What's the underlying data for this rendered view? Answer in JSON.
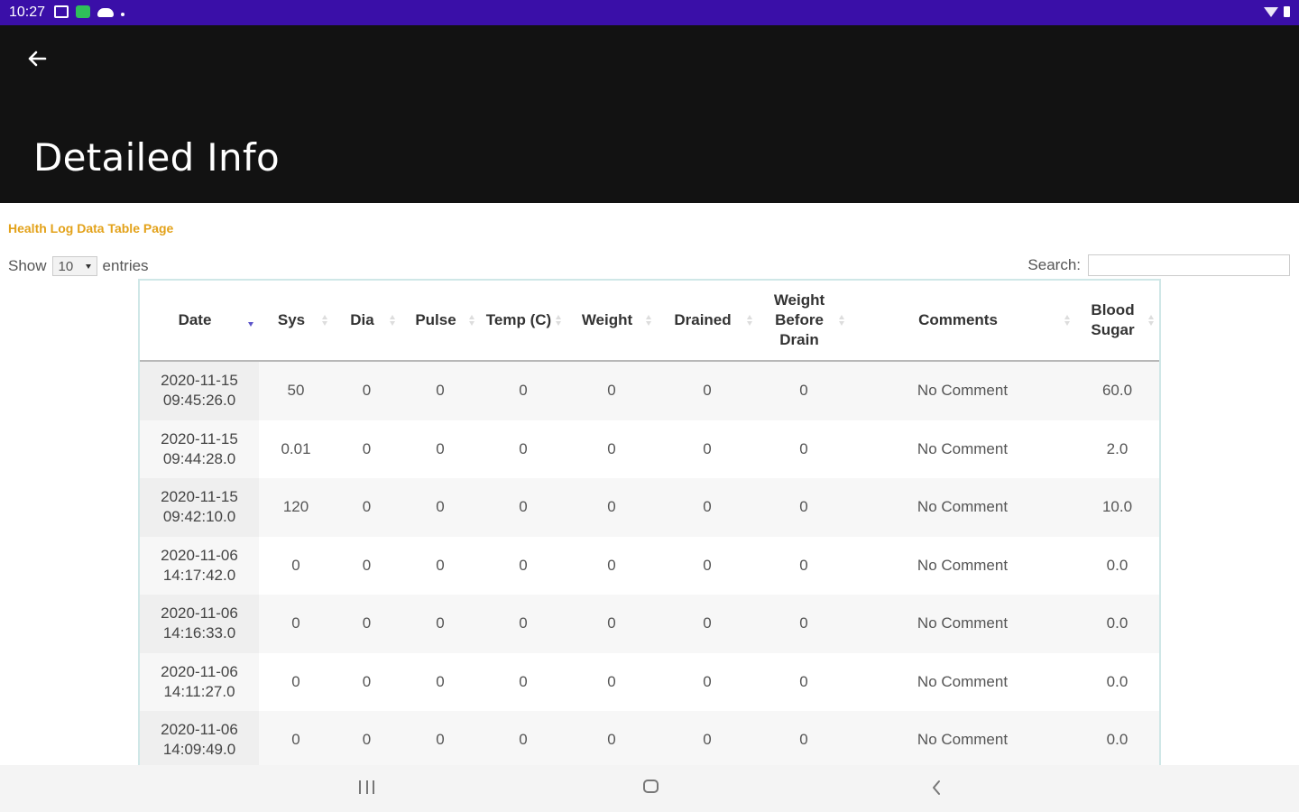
{
  "status_bar": {
    "time": "10:27",
    "icons": [
      "photo-icon",
      "app-icon",
      "cloud-icon",
      "dot-icon",
      "wifi-icon",
      "battery-icon"
    ],
    "background": "#3a0fa8"
  },
  "toolbar": {
    "title": "Detailed Info",
    "background": "#121212",
    "back_icon": "arrow-left-icon"
  },
  "page": {
    "subtitle": "Health Log Data Table Page",
    "subtitle_color": "#e3a21a",
    "show_label": "Show",
    "entries_value": "10",
    "entries_label": "entries",
    "search_label": "Search:",
    "search_value": ""
  },
  "table": {
    "columns": [
      "Date",
      "Sys",
      "Dia",
      "Pulse",
      "Temp (C)",
      "Weight",
      "Drained",
      "Weight Before Drain",
      "Comments",
      "Blood Sugar"
    ],
    "sorted_column": "Date",
    "sort_direction": "descending",
    "rows": [
      [
        "2020-11-15\n09:45:26.0",
        "50",
        "0",
        "0",
        "0",
        "0",
        "0",
        "0",
        "No Comment",
        "60.0"
      ],
      [
        "2020-11-15\n09:44:28.0",
        "0.01",
        "0",
        "0",
        "0",
        "0",
        "0",
        "0",
        "No Comment",
        "2.0"
      ],
      [
        "2020-11-15\n09:42:10.0",
        "120",
        "0",
        "0",
        "0",
        "0",
        "0",
        "0",
        "No Comment",
        "10.0"
      ],
      [
        "2020-11-06\n14:17:42.0",
        "0",
        "0",
        "0",
        "0",
        "0",
        "0",
        "0",
        "No Comment",
        "0.0"
      ],
      [
        "2020-11-06\n14:16:33.0",
        "0",
        "0",
        "0",
        "0",
        "0",
        "0",
        "0",
        "No Comment",
        "0.0"
      ],
      [
        "2020-11-06\n14:11:27.0",
        "0",
        "0",
        "0",
        "0",
        "0",
        "0",
        "0",
        "No Comment",
        "0.0"
      ],
      [
        "2020-11-06\n14:09:49.0",
        "0",
        "0",
        "0",
        "0",
        "0",
        "0",
        "0",
        "No Comment",
        "0.0"
      ]
    ]
  },
  "nav_bar": {
    "icons": [
      "recents-icon",
      "home-icon",
      "back-icon"
    ]
  }
}
